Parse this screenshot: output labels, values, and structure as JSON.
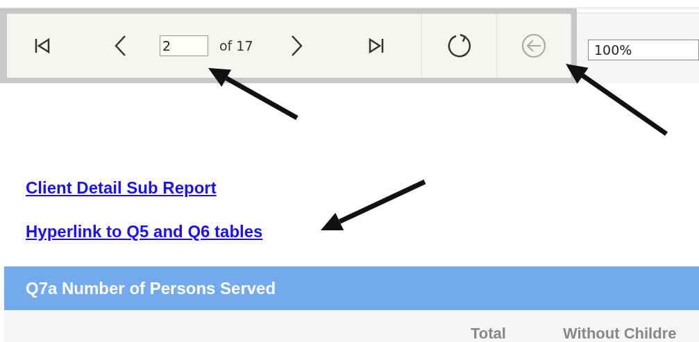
{
  "toolbar": {
    "page_input": "2",
    "page_count": "of 17",
    "back_disabled": true,
    "zoom": "100%"
  },
  "links": [
    "Client Detail Sub Report",
    "Hyperlink to Q5 and Q6 tables"
  ],
  "section": {
    "title": "Q7a Number of Persons Served",
    "columns": [
      "Total",
      "Without Childre"
    ]
  }
}
